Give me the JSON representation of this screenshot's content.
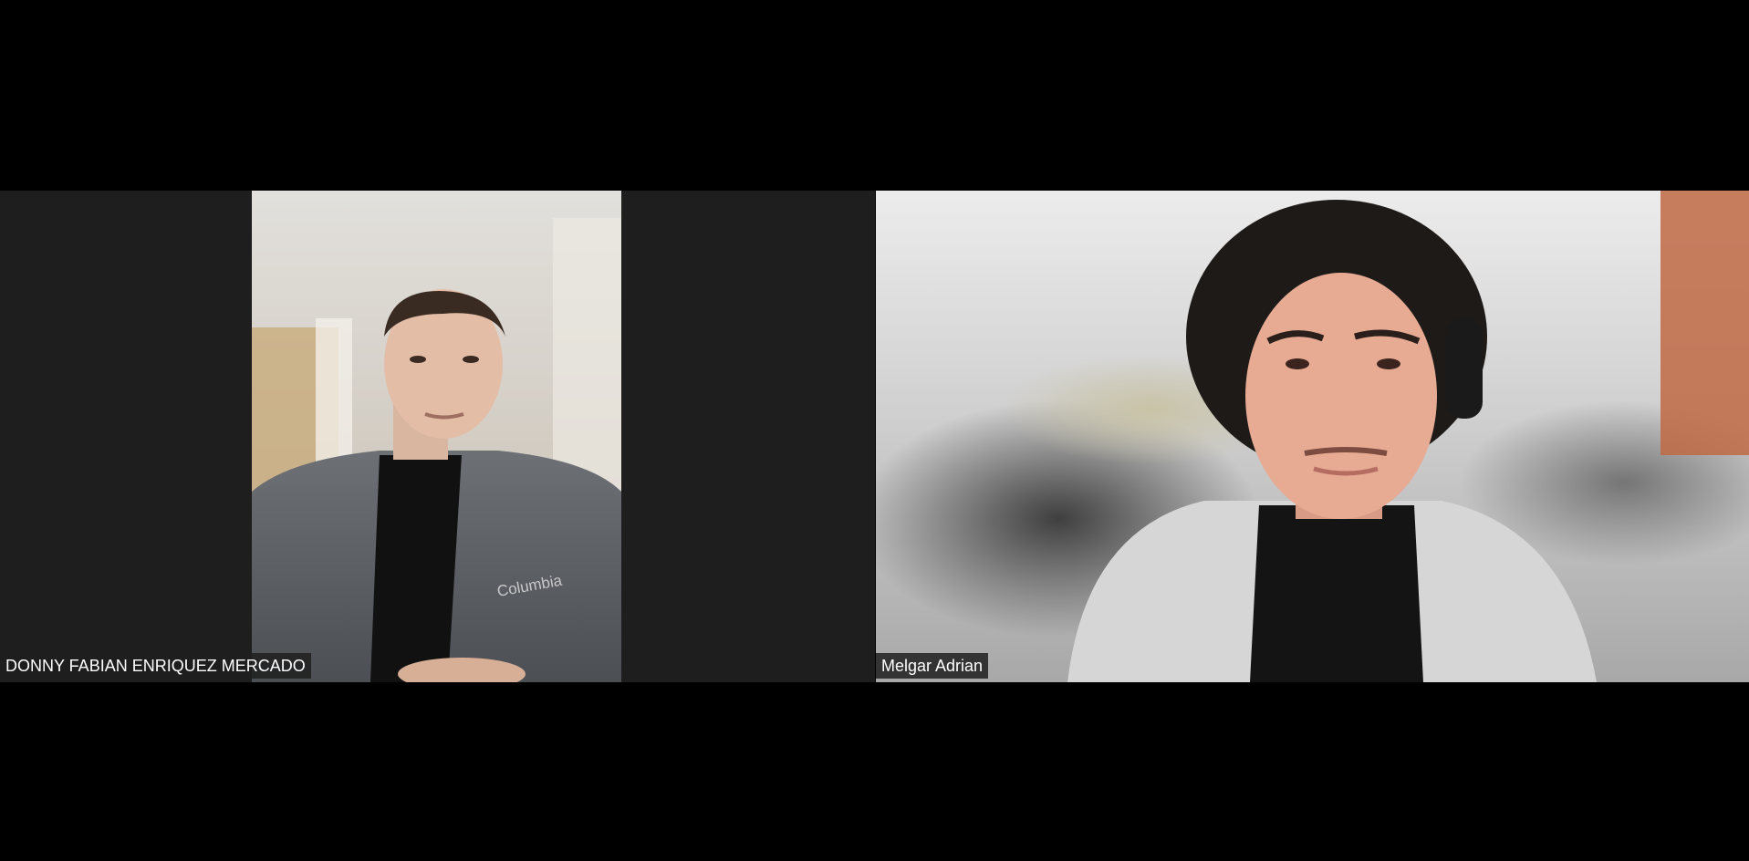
{
  "participants": [
    {
      "name": "DONNY FABIAN ENRIQUEZ MERCADO",
      "shirt_logo": "Columbia"
    },
    {
      "name": "Melgar Adrian"
    }
  ],
  "colors": {
    "background": "#000000",
    "tile_background": "#1e1e1e",
    "name_tag_background": "#1e1e1e",
    "name_tag_text": "#ffffff"
  }
}
